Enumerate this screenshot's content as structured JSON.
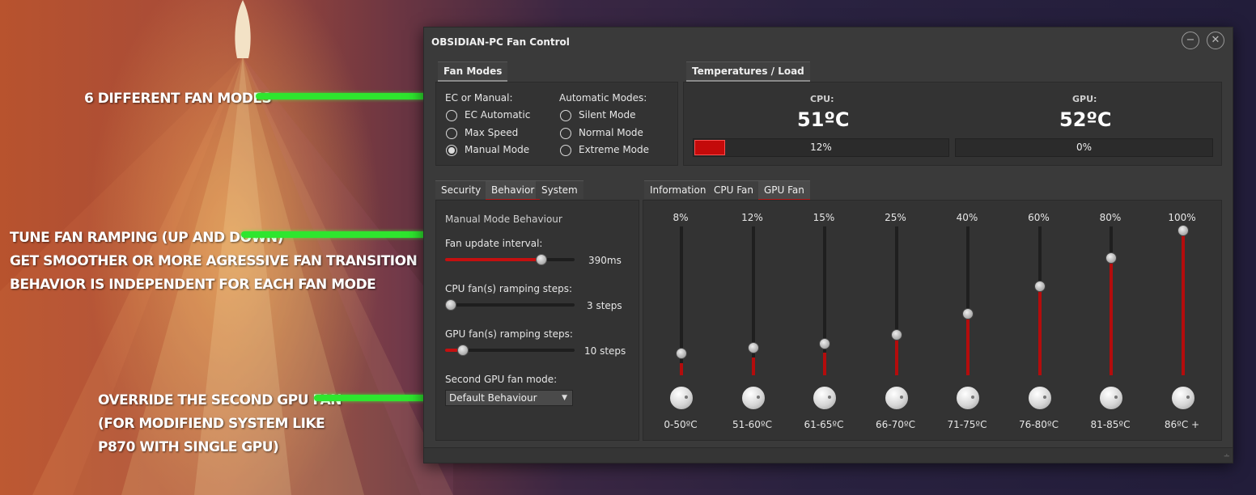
{
  "annotations": {
    "fan_modes": [
      "6 different fan modes"
    ],
    "ramping": [
      "Tune fan ramping (Up and down)",
      "Get smoother or more agressive fan transition",
      "behavior is independent for each fan mode"
    ],
    "gpu_override": [
      "Override  the second GPU fan",
      "(for modifiend system like",
      "P870 with single GPU)"
    ]
  },
  "window": {
    "title": "OBSIDIAN-PC Fan Control",
    "minimize_icon": "minus-circle-icon",
    "close_icon": "close-circle-icon"
  },
  "fan_modes": {
    "tab": "Fan Modes",
    "ec_heading": "EC or Manual:",
    "auto_heading": "Automatic Modes:",
    "ec_options": [
      {
        "label": "EC Automatic",
        "checked": false
      },
      {
        "label": "Max Speed",
        "checked": false
      },
      {
        "label": "Manual Mode",
        "checked": true
      }
    ],
    "auto_options": [
      {
        "label": "Silent Mode",
        "checked": false
      },
      {
        "label": "Normal Mode",
        "checked": false
      },
      {
        "label": "Extreme Mode",
        "checked": false
      }
    ]
  },
  "temperatures": {
    "tab": "Temperatures / Load",
    "cpu": {
      "label": "CPU:",
      "temp": "51ºC",
      "load_text": "12%",
      "load": 0.12
    },
    "gpu": {
      "label": "GPU:",
      "temp": "52ºC",
      "load_text": "0%",
      "load": 0.0
    }
  },
  "left_tabs": [
    {
      "label": "Security",
      "active": false
    },
    {
      "label": "Behavior",
      "active": true
    },
    {
      "label": "System",
      "active": false
    }
  ],
  "behavior": {
    "heading": "Manual Mode Behaviour",
    "update_interval": {
      "label": "Fan update interval:",
      "value_text": "390ms",
      "fraction": 0.76
    },
    "cpu_ramping": {
      "label": "CPU fan(s) ramping steps:",
      "value_text": "3 steps",
      "fraction": 0.0
    },
    "gpu_ramping": {
      "label": "GPU fan(s) ramping steps:",
      "value_text": "10 steps",
      "fraction": 0.1
    },
    "second_gpu": {
      "label": "Second GPU fan mode:",
      "selected": "Default Behaviour"
    }
  },
  "right_tabs": [
    {
      "label": "Information",
      "active": false
    },
    {
      "label": "CPU Fan",
      "active": false
    },
    {
      "label": "GPU Fan",
      "active": true
    }
  ],
  "gpu_fan_curve": [
    {
      "percent_text": "8%",
      "value": 0.08,
      "range": "0-50ºC"
    },
    {
      "percent_text": "12%",
      "value": 0.12,
      "range": "51-60ºC"
    },
    {
      "percent_text": "15%",
      "value": 0.15,
      "range": "61-65ºC"
    },
    {
      "percent_text": "25%",
      "value": 0.25,
      "range": "66-70ºC"
    },
    {
      "percent_text": "40%",
      "value": 0.4,
      "range": "71-75ºC"
    },
    {
      "percent_text": "60%",
      "value": 0.6,
      "range": "76-80ºC"
    },
    {
      "percent_text": "80%",
      "value": 0.8,
      "range": "81-85ºC"
    },
    {
      "percent_text": "100%",
      "value": 1.0,
      "range": "86ºC +"
    }
  ],
  "colors": {
    "accent_red": "#c40a0a",
    "connector_green": "#2ee62e"
  }
}
